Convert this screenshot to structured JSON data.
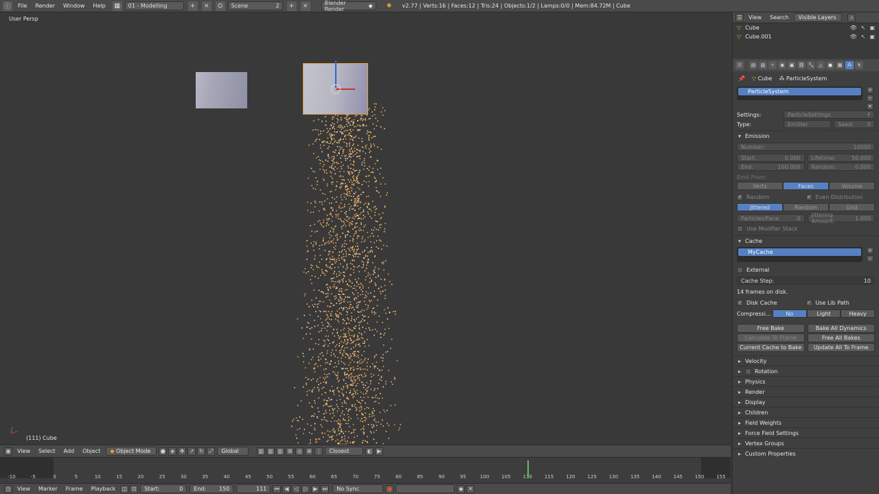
{
  "topbar": {
    "menus": [
      "File",
      "Render",
      "Window",
      "Help"
    ],
    "layout": "01 - Modelling",
    "scene": "Scene",
    "scene_users": "2",
    "engine": "Blender Render",
    "stats": "v2.77 | Verts:16 | Faces:12 | Tris:24 | Objects:1/2 | Lamps:0/0 | Mem:84.72M | Cube"
  },
  "viewport": {
    "label": "User Persp",
    "object": "(111) Cube"
  },
  "vp_header": {
    "view": "View",
    "select": "Select",
    "add": "Add",
    "object": "Object",
    "mode": "Object Mode",
    "orientation": "Global",
    "snap": "Closest"
  },
  "timeline": {
    "ticks": [
      "-10",
      "-5",
      "0",
      "5",
      "10",
      "15",
      "20",
      "25",
      "30",
      "35",
      "40",
      "45",
      "50",
      "55",
      "60",
      "65",
      "70",
      "75",
      "80",
      "85",
      "90",
      "95",
      "100",
      "105",
      "110",
      "115",
      "120",
      "125",
      "130",
      "135",
      "140",
      "145",
      "150",
      "155"
    ],
    "current_frame": 111,
    "view": "View",
    "marker": "Marker",
    "frame": "Frame",
    "playback": "Playback",
    "start_label": "Start:",
    "start_value": "0",
    "end_label": "End:",
    "end_value": "150",
    "current_value": "111",
    "sync": "No Sync"
  },
  "outliner": {
    "view": "View",
    "search": "Search",
    "layers": "Visible Layers",
    "items": [
      "Cube",
      "Cube.001"
    ]
  },
  "properties": {
    "crumb_object": "Cube",
    "crumb_psys": "ParticleSystem",
    "psys_name": "ParticleSystem",
    "settings_label": "Settings:",
    "settings_value": "ParticleSettings",
    "settings_users": "F",
    "type_label": "Type:",
    "type_value": "Emitter",
    "seed_label": "Seed:",
    "seed_value": "0",
    "emission": {
      "title": "Emission",
      "number_label": "Number:",
      "number_value": "10000",
      "start_label": "Start:",
      "start_value": "0.000",
      "end_label": "End:",
      "end_value": "100.000",
      "lifetime_label": "Lifetime:",
      "lifetime_value": "50.000",
      "random_label": "Random:",
      "random_value": "0.000",
      "emit_from": "Emit From:",
      "emit_opts": [
        "Verts",
        "Faces",
        "Volume"
      ],
      "random_chk": "Random",
      "even_dist": "Even Distribution",
      "dist_opts": [
        "Jittered",
        "Random",
        "Grid"
      ],
      "ppf_label": "Particles/Face:",
      "ppf_value": "0",
      "jitter_label": "Jittering Amount:",
      "jitter_value": "1.000",
      "modifier_stack": "Use Modifier Stack"
    },
    "cache": {
      "title": "Cache",
      "name": "MyCache",
      "external": "External",
      "step_label": "Cache Step:",
      "step_value": "10",
      "frames_info": "14 frames on disk.",
      "disk_cache": "Disk Cache",
      "lib_path": "Use Lib Path",
      "compress_label": "Compressi...",
      "compress_opts": [
        "No",
        "Light",
        "Heavy"
      ],
      "free_bake": "Free Bake",
      "bake_all": "Bake All Dynamics",
      "calc_to_frame": "Calculate To Frame",
      "free_all": "Free All Bakes",
      "cache_to_bake": "Current Cache to Bake",
      "update_all": "Update All To Frame"
    },
    "collapsed": [
      "Velocity",
      "Rotation",
      "Physics",
      "Render",
      "Display",
      "Children",
      "Field Weights",
      "Force Field Settings",
      "Vertex Groups",
      "Custom Properties"
    ]
  }
}
